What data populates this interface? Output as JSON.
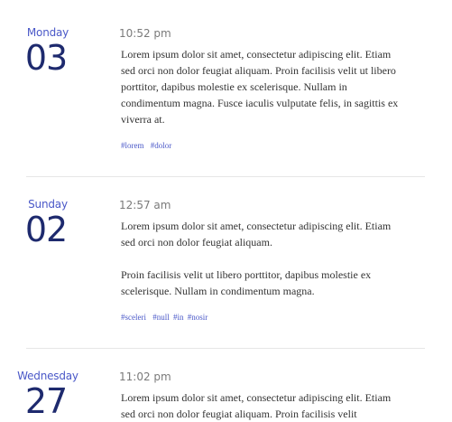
{
  "entries": [
    {
      "day_name": "Monday",
      "day_number": "03",
      "time": "10:52 pm",
      "paragraphs": [
        "Lorem ipsum dolor sit amet, consectetur adipiscing elit. Etiam sed orci non dolor feugiat aliquam. Proin facilisis velit ut libero porttitor, dapibus molestie ex scelerisque. Nullam in condimentum magna. Fusce iaculis vulputate felis, in sagittis ex viverra at."
      ],
      "tags": [
        "#lorem",
        "#dolor"
      ]
    },
    {
      "day_name": "Sunday",
      "day_number": "02",
      "time": "12:57 am",
      "paragraphs": [
        "Lorem ipsum dolor sit amet, consectetur adipiscing elit. Etiam sed orci non dolor feugiat aliquam.",
        "Proin facilisis velit ut libero porttitor, dapibus molestie ex scelerisque. Nullam in condimentum magna."
      ],
      "tags": [
        "#sceleri",
        "#null",
        "#in",
        "#nosir"
      ]
    },
    {
      "day_name": "Wednesday",
      "day_number": "27",
      "time": "11:02 pm",
      "paragraphs": [
        "Lorem ipsum dolor sit amet, consectetur adipiscing elit. Etiam sed orci non dolor feugiat aliquam. Proin facilisis velit"
      ],
      "tags": []
    }
  ]
}
